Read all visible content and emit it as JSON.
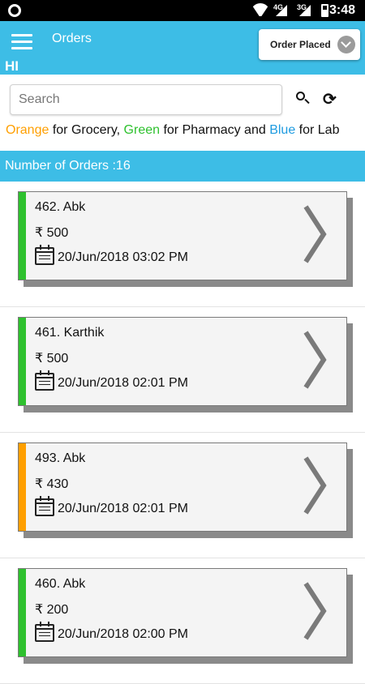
{
  "status_bar": {
    "time": "3:48",
    "network_1": "4G",
    "network_2": "3G"
  },
  "app_bar": {
    "title": "Orders",
    "greeting": "HI",
    "status_filter": "Order Placed"
  },
  "search": {
    "placeholder": "Search"
  },
  "legend": {
    "orange_word": "Orange",
    "grocery_text": " for Grocery, ",
    "green_word": "Green",
    "pharmacy_text": " for Pharmacy and ",
    "blue_word": "Blue",
    "lab_text": " for Lab"
  },
  "colors": {
    "header": "#3dbde6",
    "orange": "#ff9f00",
    "green": "#2ec12e",
    "blue": "#1e9be0"
  },
  "orders_count": "Number of Orders :16",
  "orders": [
    {
      "title": "462.  Abk",
      "amount": "₹ 500",
      "date": "20/Jun/2018 03:02 PM",
      "category": "green"
    },
    {
      "title": "461.  Karthik",
      "amount": "₹ 500",
      "date": "20/Jun/2018 02:01 PM",
      "category": "green"
    },
    {
      "title": "493.  Abk",
      "amount": "₹ 430",
      "date": "20/Jun/2018 02:01 PM",
      "category": "orange"
    },
    {
      "title": "460.  Abk",
      "amount": "₹ 200",
      "date": "20/Jun/2018 02:00 PM",
      "category": "green"
    }
  ]
}
